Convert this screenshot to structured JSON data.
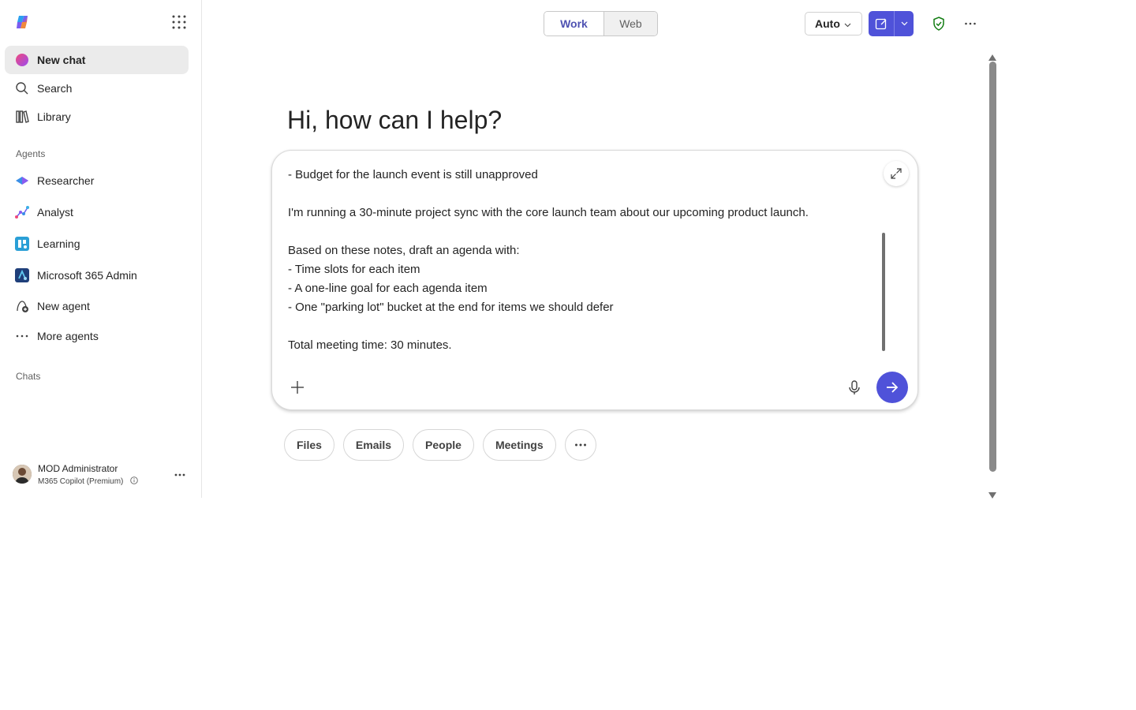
{
  "sidebar": {
    "new_chat": "New chat",
    "search": "Search",
    "library": "Library",
    "agents_heading": "Agents",
    "agents": [
      {
        "label": "Researcher",
        "icon": "researcher-icon"
      },
      {
        "label": "Analyst",
        "icon": "analyst-icon"
      },
      {
        "label": "Learning",
        "icon": "learning-icon"
      },
      {
        "label": "Microsoft 365 Admin",
        "icon": "m365-admin-icon"
      },
      {
        "label": "New agent",
        "icon": "new-agent-icon"
      },
      {
        "label": "More agents",
        "icon": "more-agents-icon"
      }
    ],
    "chats_heading": "Chats",
    "user": {
      "name": "MOD Administrator",
      "plan": "M365 Copilot (Premium)"
    }
  },
  "topbar": {
    "mode_work": "Work",
    "mode_web": "Web",
    "model_select": "Auto",
    "accent_color": "#4f52d9",
    "shield_color": "#107c10"
  },
  "main": {
    "greeting": "Hi, how can I help?",
    "prompt_lines": [
      "- Budget for the launch event is still unapproved",
      "",
      "I'm running a 30-minute project sync with the core launch team about our upcoming product launch.",
      "",
      "Based on these notes, draft an agenda with:",
      "- Time slots for each item",
      "- A one-line goal for each agenda item",
      "- One \"parking lot\" bucket at the end for items we should defer",
      "",
      "Total meeting time: 30 minutes."
    ],
    "chips": [
      "Files",
      "Emails",
      "People",
      "Meetings"
    ]
  }
}
